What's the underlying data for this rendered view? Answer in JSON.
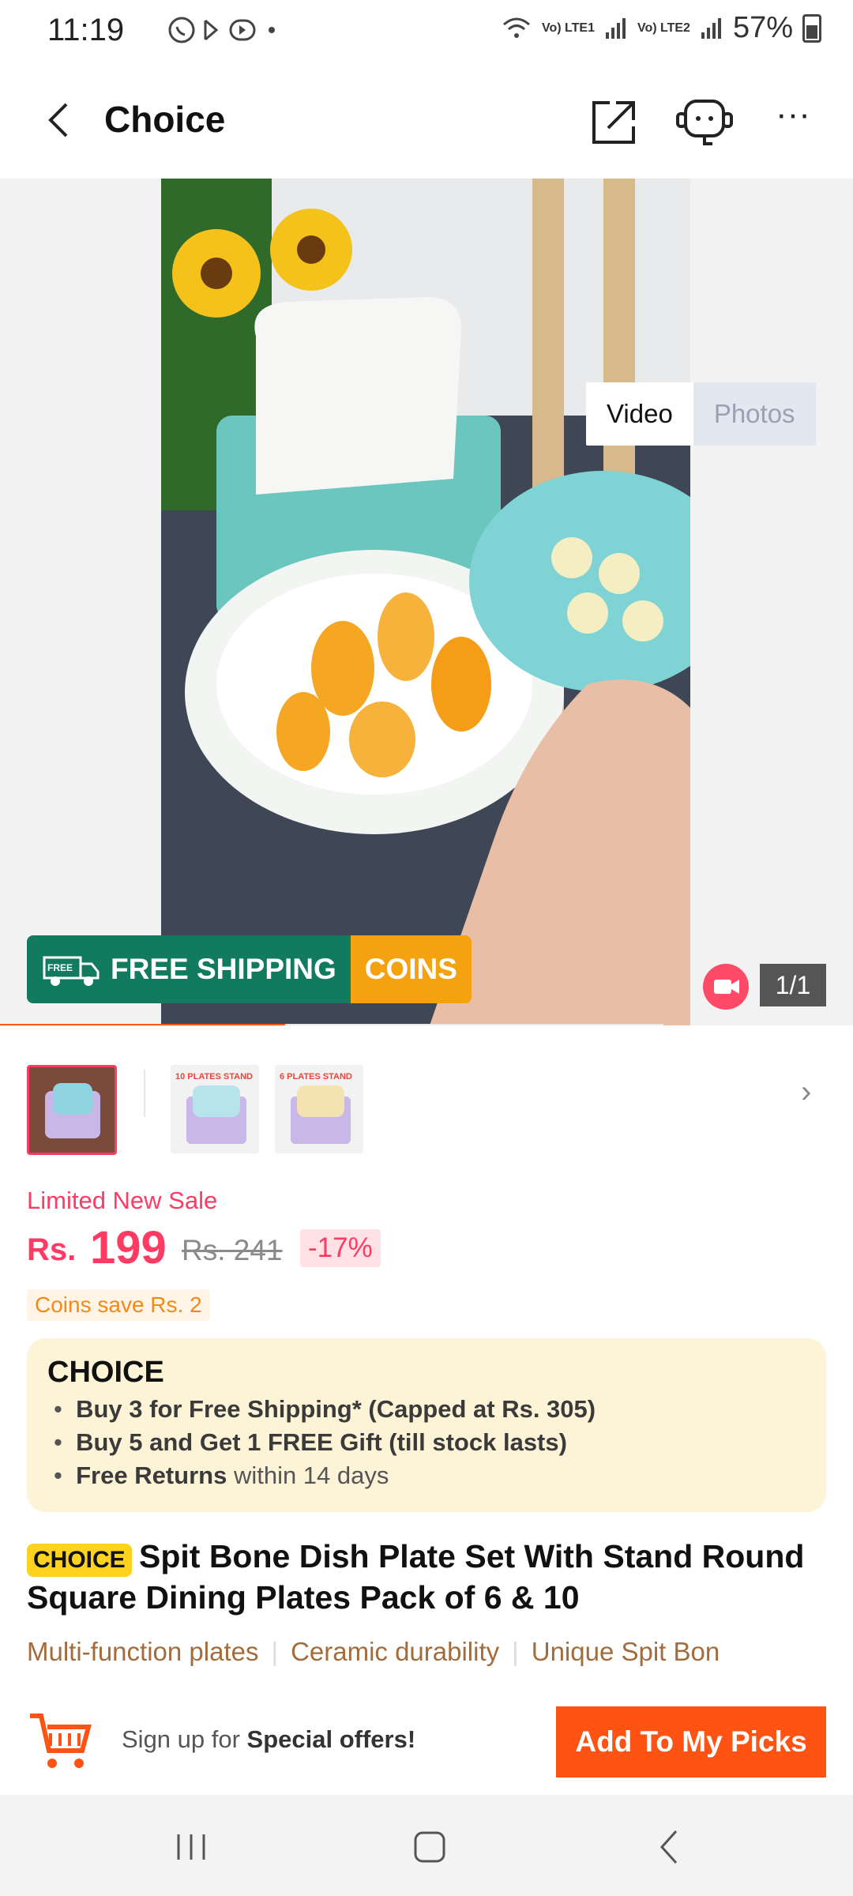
{
  "status_bar": {
    "time": "11:19",
    "left_icons": "",
    "net1": "Vo) LTE1",
    "net2": "Vo) LTE2",
    "battery": "57%"
  },
  "header": {
    "title": "Choice"
  },
  "media": {
    "tabs": [
      "Video",
      "Photos"
    ],
    "active_tab": "Video",
    "counter": "1/1",
    "banner": {
      "left_tag": "FREE",
      "left_text": "FREE SHIPPING",
      "right_text": "COINS"
    },
    "progress_fraction": 0.43
  },
  "thumbnails": [
    {
      "label": "",
      "selected": true
    },
    {
      "label": "10 PLATES STAND",
      "selected": false
    },
    {
      "label": "6 PLATES STAND",
      "selected": false
    }
  ],
  "pricing": {
    "sale_label": "Limited New Sale",
    "currency": "Rs.",
    "price": "199",
    "old_price": "Rs. 241",
    "discount": "-17%",
    "coins_save": "Coins save Rs. 2"
  },
  "choice": {
    "logo": "CHOICE",
    "bullets": [
      {
        "bold": "Buy 3 for  Free Shipping* (Capped at Rs. 305)",
        "rest": ""
      },
      {
        "bold": "Buy 5 and Get 1 FREE Gift (till stock lasts)",
        "rest": ""
      },
      {
        "bold": "Free Returns",
        "rest": " within 14 days"
      }
    ]
  },
  "product": {
    "badge": "CHOICE",
    "title": "Spit Bone Dish Plate Set With Stand Round Square Dining Plates Pack of 6 & 10"
  },
  "features": [
    "Multi-function plates",
    "Ceramic durability",
    "Unique Spit Bon"
  ],
  "footer": {
    "signup_prefix": "Sign up for ",
    "signup_bold": "Special offers!",
    "add_button": "Add To My Picks"
  },
  "colors": {
    "accent": "#ff5314",
    "price": "#ff3b64",
    "shipping_green": "#127a5e",
    "coins_orange": "#f5a211",
    "choice_bg": "#fdf3d6"
  }
}
